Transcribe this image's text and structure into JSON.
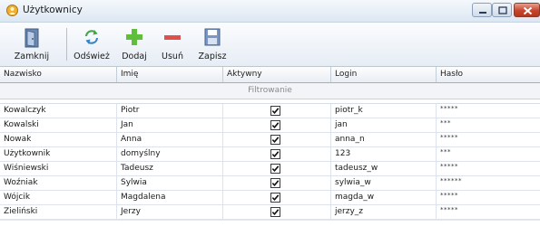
{
  "window": {
    "title": "Użytkownicy",
    "icon": "users-app-icon"
  },
  "toolbar": {
    "close_label": "Zamknij",
    "refresh_label": "Odśwież",
    "add_label": "Dodaj",
    "delete_label": "Usuń",
    "save_label": "Zapisz"
  },
  "grid": {
    "columns": [
      "Nazwisko",
      "Imię",
      "Aktywny",
      "Login",
      "Hasło"
    ],
    "filter_label": "Filtrowanie",
    "rows": [
      {
        "surname": "Kowalczyk",
        "name": "Piotr",
        "active": true,
        "login": "piotr_k",
        "password": "*****"
      },
      {
        "surname": "Kowalski",
        "name": "Jan",
        "active": true,
        "login": "jan",
        "password": "***"
      },
      {
        "surname": "Nowak",
        "name": "Anna",
        "active": true,
        "login": "anna_n",
        "password": "*****"
      },
      {
        "surname": "Użytkownik",
        "name": "domyślny",
        "active": true,
        "login": "123",
        "password": "***"
      },
      {
        "surname": "Wiśniewski",
        "name": "Tadeusz",
        "active": true,
        "login": "tadeusz_w",
        "password": "*****"
      },
      {
        "surname": "Woźniak",
        "name": "Sylwia",
        "active": true,
        "login": "sylwia_w",
        "password": "******"
      },
      {
        "surname": "Wójcik",
        "name": "Magdalena",
        "active": true,
        "login": "magda_w",
        "password": "*****"
      },
      {
        "surname": "Zieliński",
        "name": "Jerzy",
        "active": true,
        "login": "jerzy_z",
        "password": "*****"
      }
    ]
  },
  "colors": {
    "add_icon": "#5fbf3a",
    "delete_icon": "#e0504a",
    "close_button": "#c7452c"
  }
}
